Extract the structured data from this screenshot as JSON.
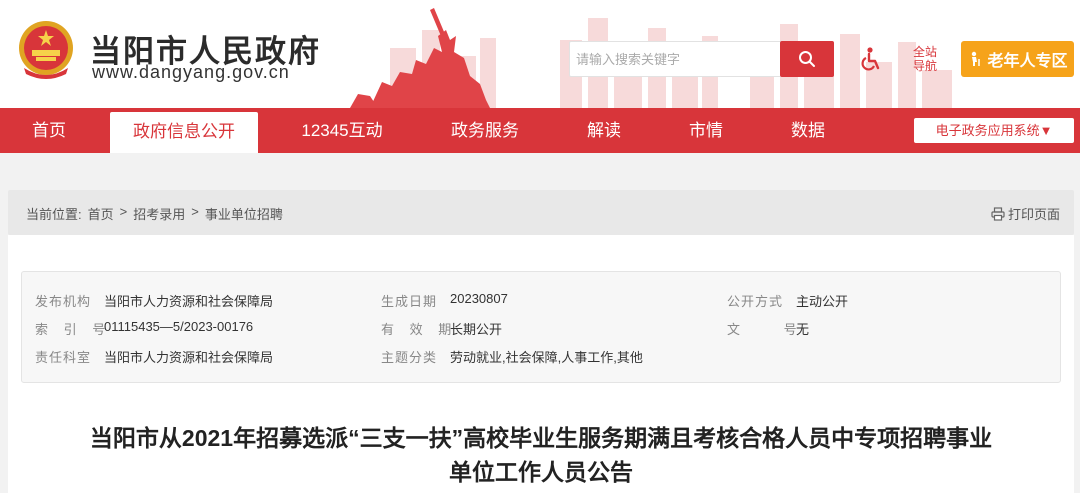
{
  "header": {
    "site_title": "当阳市人民政府",
    "site_url": "www.dangyang.gov.cn",
    "search_placeholder": "请输入搜索关键字",
    "site_nav_line1": "全站",
    "site_nav_line2": "导航",
    "elder_zone": "老年人专区",
    "icons": [
      "national-emblem",
      "search-icon",
      "accessibility-icon",
      "elder-icon"
    ]
  },
  "nav": {
    "items": [
      "首页",
      "政府信息公开",
      "12345互动",
      "政务服务",
      "解读",
      "市情",
      "数据"
    ],
    "active": "政府信息公开",
    "system_select": "电子政务应用系统▼"
  },
  "breadcrumb": {
    "label": "当前位置:",
    "items": [
      "首页",
      ">",
      "招考录用",
      ">",
      "事业单位招聘"
    ],
    "print": "打印页面"
  },
  "meta": {
    "publisher_label": "发布机构",
    "publisher": "当阳市人力资源和社会保障局",
    "date_label": "生成日期",
    "date": "20230807",
    "disclosure_label": "公开方式",
    "disclosure": "主动公开",
    "index_label": "索 引 号",
    "index": "01115435—5/2023-00176",
    "validity_label": "有 效 期",
    "validity": "长期公开",
    "docno_label": "文 号",
    "docno": "无",
    "dept_label": "责任科室",
    "dept": "当阳市人力资源和社会保障局",
    "topic_label": "主题分类",
    "topic": "劳动就业,社会保障,人事工作,其他"
  },
  "article": {
    "title_line1": "当阳市从2021年招募选派“三支一扶”高校毕业生服务期满且考核合格人员中专项招聘事业",
    "title_line2": "单位工作人员公告"
  },
  "colors": {
    "brand_red": "#d8353a",
    "elder_orange": "#f6a31a"
  }
}
